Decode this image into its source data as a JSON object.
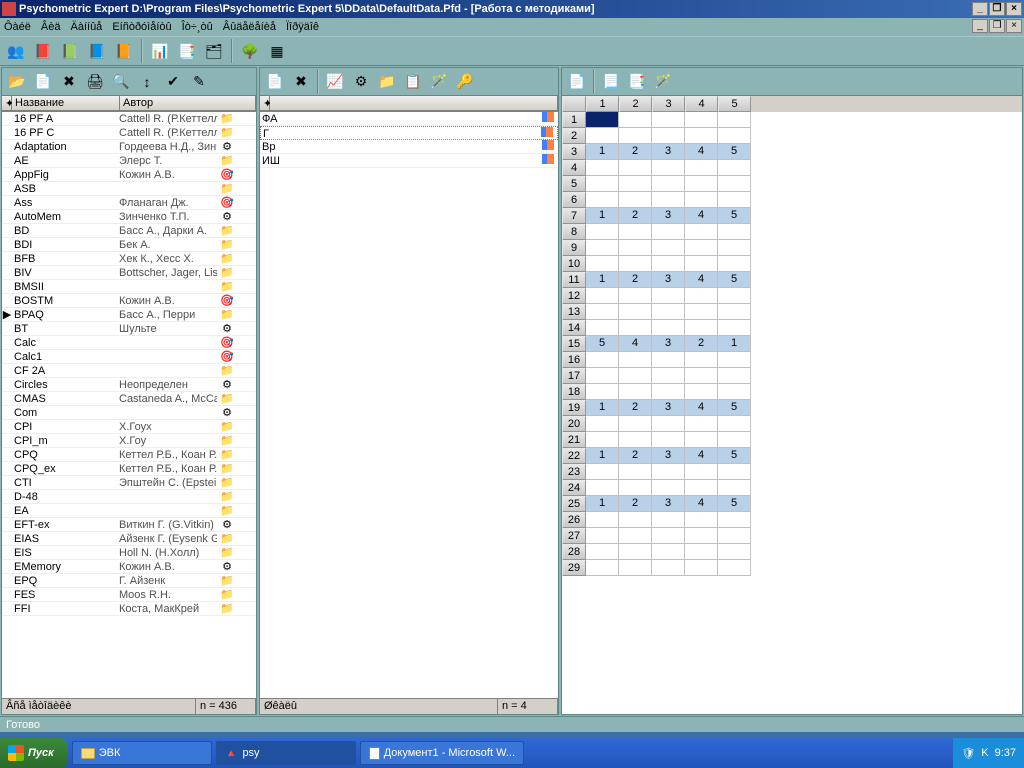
{
  "title": "Psychometric Expert D:\\Program Files\\Psychometric Expert 5\\DData\\DefaultData.Pfd - [Работа с методиками]",
  "menu": [
    "Ôàéë",
    "Âèä",
    "Äàííûå",
    "Еíñòðóìåíòû",
    "Îò÷¸òû",
    "Âûäåëåíèå",
    "Ïîðÿäîê"
  ],
  "leftHeaders": {
    "c1": "Название",
    "c2": "Автор"
  },
  "leftStatus": {
    "label": "Âñå ìåòîäèêè",
    "count": "n = 436"
  },
  "midStatus": {
    "label": "Øêàëû",
    "count": "n = 4"
  },
  "bottomStatus": "Готово",
  "leftRows": [
    {
      "n": "16 PF A",
      "a": "Cattell R. (Р.Кеттелл",
      "i": "f"
    },
    {
      "n": "16 PF C",
      "a": "Cattell R. (Р.Кеттелл",
      "i": "f"
    },
    {
      "n": "Adaptation",
      "a": "Гордеева Н.Д., Зинч",
      "i": "c"
    },
    {
      "n": "AE",
      "a": "Элерс Т.",
      "i": "f"
    },
    {
      "n": "AppFig",
      "a": "Кожин А.В.",
      "i": "g"
    },
    {
      "n": "ASB",
      "a": "",
      "i": "f"
    },
    {
      "n": "Ass",
      "a": "Фланаган Дж.",
      "i": "g"
    },
    {
      "n": "AutoMem",
      "a": "Зинченко Т.П.",
      "i": "c"
    },
    {
      "n": "BD",
      "a": "Басс А., Дарки А.",
      "i": "f"
    },
    {
      "n": "BDI",
      "a": "Бек А.",
      "i": "f"
    },
    {
      "n": "BFB",
      "a": "Хек К., Хесс Х.",
      "i": "f"
    },
    {
      "n": "BIV",
      "a": "Bottscher, Jager, Lisc",
      "i": "f"
    },
    {
      "n": "BMSII",
      "a": "",
      "i": "f"
    },
    {
      "n": "BOSTM",
      "a": "Кожин А.В.",
      "i": "g"
    },
    {
      "n": "BPAQ",
      "a": "Басс А., Перри",
      "i": "f",
      "sel": true
    },
    {
      "n": "BT",
      "a": "Шульте",
      "i": "c"
    },
    {
      "n": "Calc",
      "a": "",
      "i": "g"
    },
    {
      "n": "Calc1",
      "a": "",
      "i": "g"
    },
    {
      "n": "CF 2A",
      "a": "",
      "i": "f"
    },
    {
      "n": "Circles",
      "a": "Неопределен",
      "i": "c"
    },
    {
      "n": "CMAS",
      "a": "Castaneda A., McCar",
      "i": "f"
    },
    {
      "n": "Com",
      "a": "",
      "i": "c"
    },
    {
      "n": "CPI",
      "a": "Х.Гоух",
      "i": "f"
    },
    {
      "n": "CPI_m",
      "a": "Х.Гоу",
      "i": "f"
    },
    {
      "n": "CPQ",
      "a": "Кеттел Р.Б., Коан Р.",
      "i": "f"
    },
    {
      "n": "CPQ_ex",
      "a": "Кеттел Р.Б., Коан Р.",
      "i": "f"
    },
    {
      "n": "CTI",
      "a": "Эпштейн С. (Epstein",
      "i": "f"
    },
    {
      "n": "D-48",
      "a": "",
      "i": "f"
    },
    {
      "n": "EA",
      "a": "",
      "i": "f"
    },
    {
      "n": "EFT-ex",
      "a": "Виткин Г. (G.Vitkin)",
      "i": "c"
    },
    {
      "n": "EIAS",
      "a": "Айзенк Г. (Eysenk G",
      "i": "f"
    },
    {
      "n": "EIS",
      "a": "Holl N. (Н.Холл)",
      "i": "f"
    },
    {
      "n": "EMemory",
      "a": "Кожин А.В.",
      "i": "c"
    },
    {
      "n": "EPQ",
      "a": "Г. Айзенк",
      "i": "f"
    },
    {
      "n": "FES",
      "a": "Moos R.H.",
      "i": "f"
    },
    {
      "n": "FFI",
      "a": "Коста, МакКрей",
      "i": "f"
    }
  ],
  "midRows": [
    {
      "n": "ФА",
      "i": "b"
    },
    {
      "n": "Г",
      "i": "b",
      "sel": true
    },
    {
      "n": "Вр",
      "i": "b"
    },
    {
      "n": "ИШ",
      "i": "b"
    }
  ],
  "gridCols": [
    "1",
    "2",
    "3",
    "4",
    "5"
  ],
  "gridRows": [
    {
      "r": "1",
      "v": [
        "",
        "",
        "",
        "",
        ""
      ],
      "f": false,
      "sel": true
    },
    {
      "r": "2",
      "v": [
        "",
        "",
        "",
        "",
        ""
      ],
      "f": false
    },
    {
      "r": "3",
      "v": [
        "1",
        "2",
        "3",
        "4",
        "5"
      ],
      "f": true
    },
    {
      "r": "4",
      "v": [
        "",
        "",
        "",
        "",
        ""
      ],
      "f": false
    },
    {
      "r": "5",
      "v": [
        "",
        "",
        "",
        "",
        ""
      ],
      "f": false
    },
    {
      "r": "6",
      "v": [
        "",
        "",
        "",
        "",
        ""
      ],
      "f": false
    },
    {
      "r": "7",
      "v": [
        "1",
        "2",
        "3",
        "4",
        "5"
      ],
      "f": true
    },
    {
      "r": "8",
      "v": [
        "",
        "",
        "",
        "",
        ""
      ],
      "f": false
    },
    {
      "r": "9",
      "v": [
        "",
        "",
        "",
        "",
        ""
      ],
      "f": false
    },
    {
      "r": "10",
      "v": [
        "",
        "",
        "",
        "",
        ""
      ],
      "f": false
    },
    {
      "r": "11",
      "v": [
        "1",
        "2",
        "3",
        "4",
        "5"
      ],
      "f": true
    },
    {
      "r": "12",
      "v": [
        "",
        "",
        "",
        "",
        ""
      ],
      "f": false
    },
    {
      "r": "13",
      "v": [
        "",
        "",
        "",
        "",
        ""
      ],
      "f": false
    },
    {
      "r": "14",
      "v": [
        "",
        "",
        "",
        "",
        ""
      ],
      "f": false
    },
    {
      "r": "15",
      "v": [
        "5",
        "4",
        "3",
        "2",
        "1"
      ],
      "f": true
    },
    {
      "r": "16",
      "v": [
        "",
        "",
        "",
        "",
        ""
      ],
      "f": false
    },
    {
      "r": "17",
      "v": [
        "",
        "",
        "",
        "",
        ""
      ],
      "f": false
    },
    {
      "r": "18",
      "v": [
        "",
        "",
        "",
        "",
        ""
      ],
      "f": false
    },
    {
      "r": "19",
      "v": [
        "1",
        "2",
        "3",
        "4",
        "5"
      ],
      "f": true
    },
    {
      "r": "20",
      "v": [
        "",
        "",
        "",
        "",
        ""
      ],
      "f": false
    },
    {
      "r": "21",
      "v": [
        "",
        "",
        "",
        "",
        ""
      ],
      "f": false
    },
    {
      "r": "22",
      "v": [
        "1",
        "2",
        "3",
        "4",
        "5"
      ],
      "f": true
    },
    {
      "r": "23",
      "v": [
        "",
        "",
        "",
        "",
        ""
      ],
      "f": false
    },
    {
      "r": "24",
      "v": [
        "",
        "",
        "",
        "",
        ""
      ],
      "f": false
    },
    {
      "r": "25",
      "v": [
        "1",
        "2",
        "3",
        "4",
        "5"
      ],
      "f": true
    },
    {
      "r": "26",
      "v": [
        "",
        "",
        "",
        "",
        ""
      ],
      "f": false
    },
    {
      "r": "27",
      "v": [
        "",
        "",
        "",
        "",
        ""
      ],
      "f": false
    },
    {
      "r": "28",
      "v": [
        "",
        "",
        "",
        "",
        ""
      ],
      "f": false
    },
    {
      "r": "29",
      "v": [
        "",
        "",
        "",
        "",
        ""
      ],
      "f": false
    }
  ],
  "taskbar": {
    "start": "Пуск",
    "tasks": [
      {
        "label": "ЭВК",
        "icon": "folder"
      },
      {
        "label": "psy",
        "icon": "app",
        "active": true
      },
      {
        "label": "Документ1 - Microsoft W...",
        "icon": "doc"
      }
    ],
    "time": "9:37"
  }
}
